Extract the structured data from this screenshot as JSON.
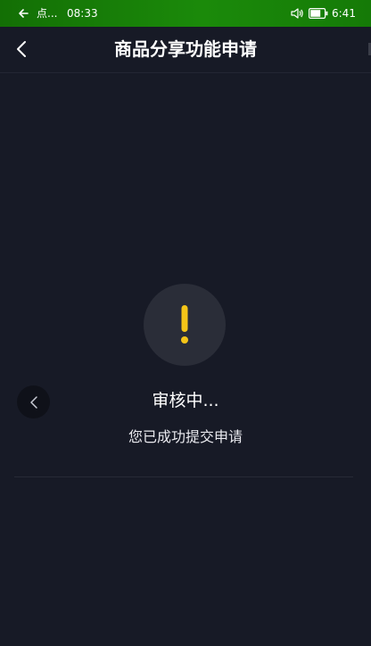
{
  "status_bar": {
    "app_label": "点...",
    "time": "08:33",
    "clock": "6:41"
  },
  "nav": {
    "title": "商品分享功能申请"
  },
  "main": {
    "status_title": "审核中...",
    "status_message": "您已成功提交申请",
    "status_icon": "exclamation-icon",
    "accent_color": "#f5c518"
  },
  "colors": {
    "background": "#171a26",
    "status_bar": "#1b8a0a",
    "icon_circle": "#2a2d38"
  }
}
